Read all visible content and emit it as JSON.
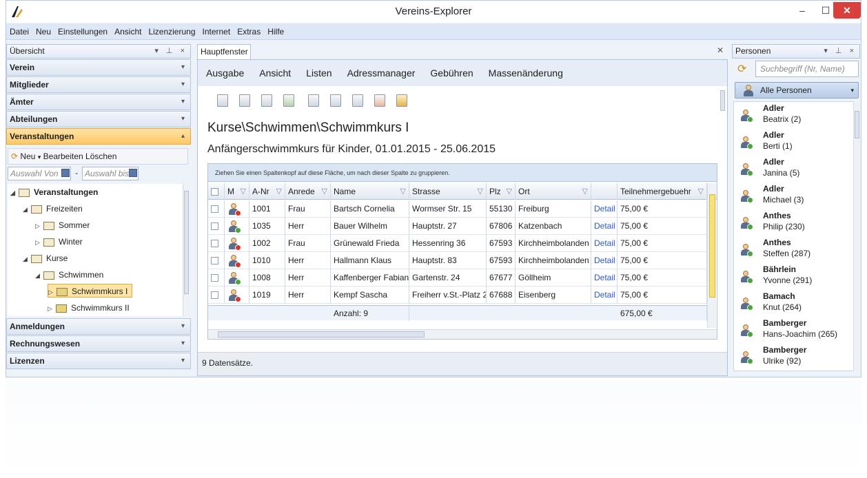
{
  "window": {
    "title": "Vereins-Explorer",
    "min": "–",
    "max": "☐",
    "close": "✕"
  },
  "menu": [
    "Datei",
    "Neu",
    "Einstellungen",
    "Ansicht",
    "Lizenzierung",
    "Internet",
    "Extras",
    "Hilfe"
  ],
  "left_pane": {
    "title": "Übersicht",
    "controls": "▾ ⊥ ×",
    "categories": [
      {
        "label": "Verein",
        "active": false
      },
      {
        "label": "Mitglieder",
        "active": false
      },
      {
        "label": "Ämter",
        "active": false
      },
      {
        "label": "Abteilungen",
        "active": false
      },
      {
        "label": "Veranstaltungen",
        "active": true
      },
      {
        "label": "Anmeldungen",
        "active": false
      },
      {
        "label": "Rechnungswesen",
        "active": false
      },
      {
        "label": "Lizenzen",
        "active": false
      }
    ],
    "toolbar": {
      "new": "Neu",
      "edit": "Bearbeiten",
      "delete": "Löschen"
    },
    "date_from": "Auswahl Von",
    "date_to": "Auswahl bis",
    "date_sep": "-",
    "tree": [
      {
        "label": "Veranstaltungen",
        "bold": true,
        "level": 0,
        "exp": "◢"
      },
      {
        "label": "Freizeiten",
        "bold": false,
        "level": 1,
        "exp": "◢"
      },
      {
        "label": "Sommer",
        "bold": false,
        "level": 2,
        "exp": "▷"
      },
      {
        "label": "Winter",
        "bold": false,
        "level": 2,
        "exp": "▷"
      },
      {
        "label": "Kurse",
        "bold": false,
        "level": 1,
        "exp": "◢"
      },
      {
        "label": "Schwimmen",
        "bold": false,
        "level": 2,
        "exp": "◢"
      },
      {
        "label": "Schwimmkurs I",
        "bold": false,
        "level": 3,
        "exp": "▷",
        "selected": true
      },
      {
        "label": "Schwimmkurs II",
        "bold": false,
        "level": 3,
        "exp": "▷"
      }
    ]
  },
  "document": {
    "tab": "Hauptfenster",
    "ribbon": [
      "Ausgabe",
      "Ansicht",
      "Listen",
      "Adressmanager",
      "Gebühren",
      "Massenänderung"
    ],
    "title": "Kurse\\Schwimmen\\Schwimmkurs I",
    "subtitle": "Anfängerschwimmkurs für Kinder, 01.01.2015 - 25.06.2015",
    "group_hint": "Ziehen Sie einen Spaltenkopf auf diese Fläche, um nach dieser Spalte zu gruppieren.",
    "columns": [
      "",
      "M",
      "A-Nr",
      "Anrede",
      "Name",
      "Strasse",
      "Plz",
      "Ort",
      "",
      "Teilnehmergebuehr"
    ],
    "rows": [
      {
        "badge": "red",
        "nr": "1001",
        "anrede": "Frau",
        "name": "Bartsch Cornelia",
        "strasse": "Wormser Str. 15",
        "plz": "55130",
        "ort": "Freiburg",
        "detail": "Detail",
        "fee": "75,00 €"
      },
      {
        "badge": "green",
        "nr": "1035",
        "anrede": "Herr",
        "name": "Bauer Wilhelm",
        "strasse": "Hauptstr. 27",
        "plz": "67806",
        "ort": "Katzenbach",
        "detail": "Detail",
        "fee": "75,00 €"
      },
      {
        "badge": "red",
        "nr": "1002",
        "anrede": "Frau",
        "name": "Grünewald Frieda",
        "strasse": "Hessenring 36",
        "plz": "67593",
        "ort": "Kirchheimbolanden",
        "detail": "Detail",
        "fee": "75,00 €"
      },
      {
        "badge": "red",
        "nr": "1010",
        "anrede": "Herr",
        "name": "Hallmann Klaus",
        "strasse": "Hauptstr. 83",
        "plz": "67593",
        "ort": "Kirchheimbolanden",
        "detail": "Detail",
        "fee": "75,00 €"
      },
      {
        "badge": "green",
        "nr": "1008",
        "anrede": "Herr",
        "name": "Kaffenberger Fabian",
        "strasse": "Gartenstr. 24",
        "plz": "67677",
        "ort": "Göllheim",
        "detail": "Detail",
        "fee": "75,00 €"
      },
      {
        "badge": "red",
        "nr": "1019",
        "anrede": "Herr",
        "name": "Kempf Sascha",
        "strasse": "Freiherr v.St.-Platz 2",
        "plz": "67688",
        "ort": "Eisenberg",
        "detail": "Detail",
        "fee": "75,00 €"
      }
    ],
    "summary_count": "Anzahl: 9",
    "summary_fee": "675,00 €",
    "status": "9 Datensätze."
  },
  "right_pane": {
    "title": "Personen",
    "controls": "▾ ⊥ ×",
    "search_placeholder": "Suchbegriff (Nr, Name)",
    "all_button": "Alle Personen",
    "people": [
      {
        "last": "Adler",
        "first": "Beatrix (2)"
      },
      {
        "last": "Adler",
        "first": "Berti (1)"
      },
      {
        "last": "Adler",
        "first": "Janina (5)"
      },
      {
        "last": "Adler",
        "first": "Michael (3)"
      },
      {
        "last": "Anthes",
        "first": "Philip (230)"
      },
      {
        "last": "Anthes",
        "first": "Steffen (287)"
      },
      {
        "last": "Bährlein",
        "first": "Yvonne (291)"
      },
      {
        "last": "Bamach",
        "first": "Knut (264)"
      },
      {
        "last": "Bamberger",
        "first": "Hans-Joachim (265)"
      },
      {
        "last": "Bamberger",
        "first": "Ulrike (92)"
      }
    ]
  },
  "colors": {
    "accent_active": "#ffc964",
    "badge_red": "#d8342a",
    "badge_green": "#4aa43a",
    "link": "#2b57c9"
  }
}
